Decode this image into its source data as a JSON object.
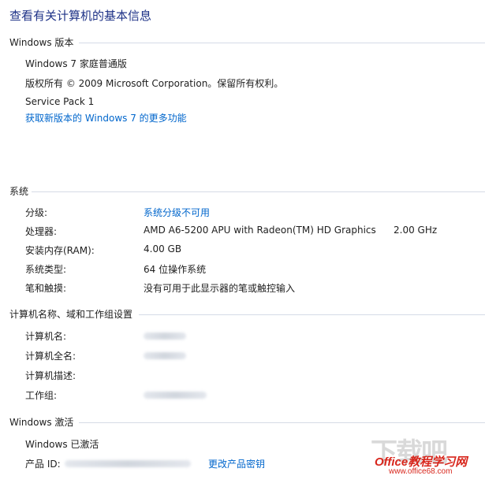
{
  "page_title": "查看有关计算机的基本信息",
  "windows_edition": {
    "heading": "Windows 版本",
    "edition": "Windows 7 家庭普通版",
    "copyright": "版权所有 © 2009 Microsoft Corporation。保留所有权利。",
    "service_pack": "Service Pack 1",
    "upgrade_link": "获取新版本的 Windows 7 的更多功能"
  },
  "system": {
    "heading": "系统",
    "rating_label": "分级:",
    "rating_value": "系统分级不可用",
    "processor_label": "处理器:",
    "processor_value": "AMD A6-5200 APU with Radeon(TM) HD Graphics",
    "processor_speed": "2.00 GHz",
    "ram_label": "安装内存(RAM):",
    "ram_value": "4.00 GB",
    "type_label": "系统类型:",
    "type_value": "64 位操作系统",
    "pen_label": "笔和触摸:",
    "pen_value": "没有可用于此显示器的笔或触控输入"
  },
  "computer_name": {
    "heading": "计算机名称、域和工作组设置",
    "name_label": "计算机名:",
    "fullname_label": "计算机全名:",
    "description_label": "计算机描述:",
    "workgroup_label": "工作组:"
  },
  "activation": {
    "heading": "Windows 激活",
    "status": "Windows 已激活",
    "product_id_label": "产品 ID:",
    "change_key_link": "更改产品密钥"
  },
  "watermark": {
    "logo": "下载吧",
    "brand": "Office教程学习网",
    "url": "www.office68.com"
  },
  "colors": {
    "title": "#1e3287",
    "link": "#0066cc",
    "rule": "#d5dbe6",
    "watermark_red": "#d8261c"
  }
}
